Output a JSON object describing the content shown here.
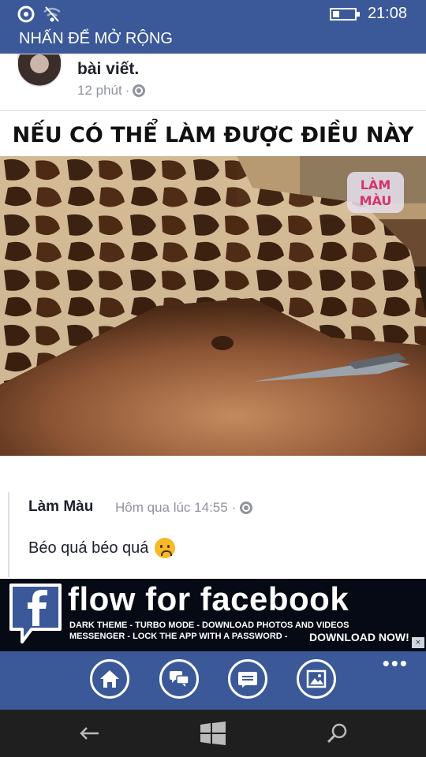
{
  "status_bar": {
    "time": "21:08",
    "battery_level": 0.3,
    "icons": [
      "data-saver-icon",
      "wifi-icon",
      "battery-icon"
    ]
  },
  "header": {
    "title": "NHẤN ĐỂ MỞ RỘNG"
  },
  "post": {
    "title": "bài viết.",
    "time": "12 phút",
    "separator": "·",
    "privacy_icon": "globe-icon",
    "meme_caption": "NẾU CÓ THỂ LÀM ĐƯỢC ĐIỀU NÀY"
  },
  "comment": {
    "author": "Làm Màu",
    "time": "Hôm qua lúc 14:55",
    "separator": "·",
    "text": "Béo quá béo quá",
    "emoji": "sad-face-icon"
  },
  "ad": {
    "title": "flow for facebook",
    "line1": "DARK THEME  -  TURBO MODE  -  DOWNLOAD  PHOTOS AND VIDEOS",
    "line2": "MESSENGER  -  LOCK THE APP WITH A PASSWORD  -",
    "cta": "DOWNLOAD NOW!",
    "close": "×"
  },
  "app_bar": {
    "buttons": [
      "home-icon",
      "messages-icon",
      "news-feed-icon",
      "photos-icon"
    ],
    "more": "•••"
  },
  "nav_bar": {
    "buttons": [
      "back-icon",
      "windows-start-icon",
      "search-icon"
    ]
  },
  "colors": {
    "facebook_blue": "#3b5998",
    "nav_dark": "#1f1f1f",
    "ad_background": "#050a14"
  }
}
